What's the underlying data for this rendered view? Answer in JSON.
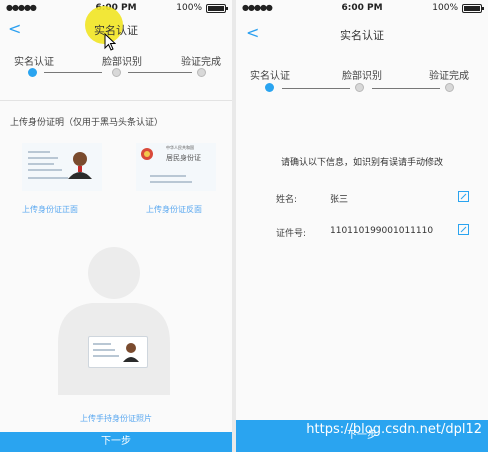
{
  "left": {
    "status": {
      "time": "6:00 PM",
      "battery": "100%"
    },
    "title": "实名认证",
    "steps": [
      "实名认证",
      "脸部识别",
      "验证完成"
    ],
    "upload_title": "上传身份证明（仅用于黑马头条认证）",
    "front_link": "上传身份证正面",
    "back_link": "上传身份证反面",
    "back_card_line1": "中华人民共和国",
    "back_card_line2": "居民身份证",
    "handheld_link": "上传手持身份证照片",
    "next_button": "下一步"
  },
  "right": {
    "status": {
      "time": "6:00 PM",
      "battery": "100%"
    },
    "title": "实名认证",
    "steps": [
      "实名认证",
      "脸部识别",
      "验证完成"
    ],
    "hint": "请确认以下信息，如识别有误请手动修改",
    "fields": [
      {
        "label": "姓名:",
        "value": "张三"
      },
      {
        "label": "证件号:",
        "value": "110110199001011110"
      }
    ],
    "next_button": "下一步"
  },
  "watermark": "https://blog.csdn.net/dpl12",
  "colors": {
    "accent": "#2aa4f0",
    "highlight": "#f1e422"
  }
}
